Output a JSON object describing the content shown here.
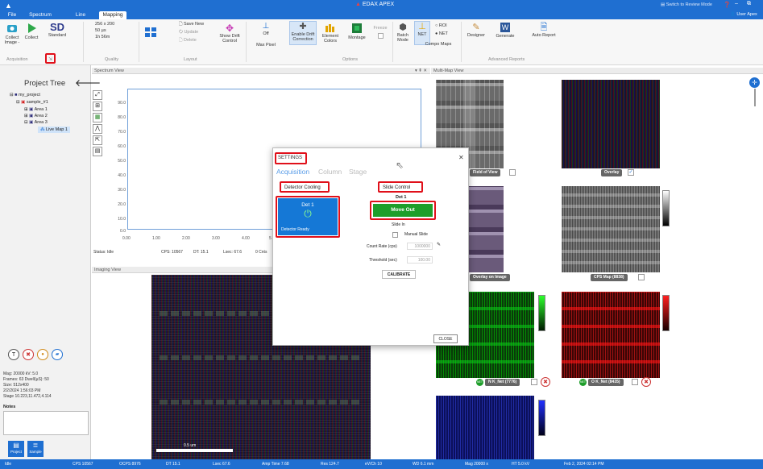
{
  "app": {
    "title": "EDAX APEX",
    "review_mode": "Switch to Review Mode",
    "user": "User Apex"
  },
  "tabs": [
    {
      "label": "File"
    },
    {
      "label": "Spectrum"
    },
    {
      "label": "Line"
    },
    {
      "label": "Mapping"
    }
  ],
  "ribbon": {
    "collect_image": "Collect Image -",
    "collect": "Collect",
    "standard": "Standard",
    "quality_res": "256 x 200",
    "quality_um": "50 µs",
    "quality_time": "1h 56m",
    "save_new": "Save New",
    "update": "Update",
    "delete": "Delete",
    "show_drift": "Show Drift Control",
    "off": "Off",
    "max_pixel": "Max Pixel",
    "enable_drift": "Enable Drift Correction",
    "element_colors": "Element Colors",
    "montage": "Montage",
    "freeze": "Freeze",
    "batch_mode": "Batch Mode",
    "net": "NET",
    "roi": "ROI",
    "net_radio": "NET",
    "designer": "Designer",
    "generate": "Generate",
    "auto_report": "Auto Report",
    "groups": {
      "acquisition": "Acquisition",
      "quality": "Quality",
      "layout": "Layout",
      "options": "Options",
      "compo_maps": "Compo Maps",
      "advanced_reports": "Advanced Reports"
    }
  },
  "project_tree": {
    "title": "Project Tree",
    "items": [
      {
        "label": "my_project"
      },
      {
        "label": "sample_#1"
      },
      {
        "label": "Area 1"
      },
      {
        "label": "Area 2"
      },
      {
        "label": "Area 3"
      },
      {
        "label": "Live Map 1"
      }
    ],
    "info": [
      "Mag: 20000 kV: 5.0",
      "Frames: 63 Dwell(µS): 50",
      "Size: 512x400",
      "2/2/2024 1:56:03 PM",
      "Stage 10.223,11.472,4.114"
    ],
    "notes_label": "Notes",
    "bottom_buttons": [
      "Project",
      "Sample"
    ]
  },
  "spectrum_view": {
    "title": "Spectrum View",
    "y_ticks": [
      "90.0",
      "80.0",
      "70.0",
      "60.0",
      "50.0",
      "40.0",
      "30.0",
      "20.0",
      "10.0",
      "0.0"
    ],
    "x_ticks": [
      "0.00",
      "1.00",
      "2.00",
      "3.00",
      "4.00",
      "5"
    ],
    "status": "Status: Idle",
    "cps": "CPS: 10567",
    "dt": "DT: 15.1",
    "lsec": "Lsec: 67.6",
    "cnts": "0 Cnts"
  },
  "imaging_view": {
    "title": "Imaging View",
    "scale": "0.5 um"
  },
  "multi_map": {
    "title": "Multi-Map View",
    "tiles": [
      {
        "label": "Field of View"
      },
      {
        "label": "Overlay",
        "checked": "✓"
      },
      {
        "label": "Overlay on Image"
      },
      {
        "label": "CPS Map (8838)"
      },
      {
        "label": "N K_Net (7776)"
      },
      {
        "label": "O K_Net (8435)"
      }
    ]
  },
  "settings": {
    "title": "SETTINGS",
    "tabs": [
      "Acquisition",
      "Column",
      "Stage"
    ],
    "detector_cooling": "Detector Cooling",
    "det1": "Det 1",
    "detector_ready": "Detector Ready",
    "slide_control": "Slide Control",
    "slide_det": "Det 1",
    "move_out": "Move Out",
    "slide_in": "Slide In",
    "manual_slide": "Manual Slide",
    "count_rate_label": "Count Rate (cps)",
    "count_rate": "1000000",
    "threshold_label": "Threshold (sec)",
    "threshold": "100.00",
    "calibrate": "CALIBRATE",
    "close": "CLOSE"
  },
  "statusbar": [
    "Idle",
    "CPS 10567",
    "OCPS 8976",
    "DT 15.1",
    "Lsec 67.6",
    "Amp Time 7.68",
    "Res 124.7",
    "eV/Ch 10",
    "WD 6.1 mm",
    "Mag 20000 x",
    "HT 5.0 kV",
    "Feb 2, 2024 02:14 PM"
  ],
  "colors": {
    "accent": "#1f6fd1",
    "highlight": "#e0101a",
    "detector": "#1578d6",
    "move_out": "#1e9e2a",
    "nk_map": "#0c8a15",
    "ok_map": "#b20e0e",
    "blue_map": "#1c2bd9"
  }
}
